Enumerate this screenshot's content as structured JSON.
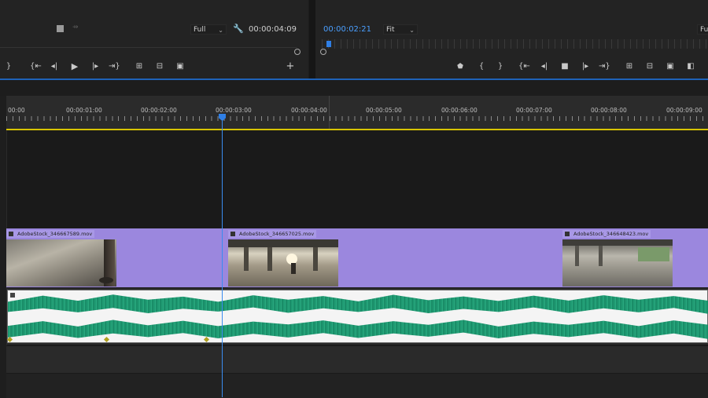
{
  "source_monitor": {
    "quality": "Full",
    "timecode": "00:00:04:09",
    "controls": [
      "}",
      "{←",
      "◂|",
      "▶",
      "|▸",
      "→}",
      "insert",
      "overwrite",
      "export-frame"
    ],
    "add_label": "+"
  },
  "program_monitor": {
    "timecode": "00:00:02:21",
    "zoom": "Fit",
    "quality": "Fu",
    "controls": [
      "marker",
      "{",
      "}",
      "{←",
      "◂|",
      "stop",
      "|▸",
      "→}",
      "lift",
      "extract",
      "export-frame",
      "compare"
    ]
  },
  "timeline": {
    "ruler_labels": [
      "00:00",
      "00:00:01:00",
      "00:00:02:00",
      "00:00:03:00",
      "00:00:04:00",
      "00:00:05:00",
      "00:00:06:00",
      "00:00:07:00",
      "00:00:08:00",
      "00:00:09:00"
    ],
    "playhead_time": "00:00:03:00",
    "clips": [
      {
        "name": "AdobeStock_346667589.mov"
      },
      {
        "name": "AdobeStock_346657025.mov"
      },
      {
        "name": "AdobeStock_346648423.mov"
      }
    ]
  },
  "colors": {
    "accent": "#2f7fe6",
    "clip_video": "#9b87de",
    "clip_audio": "#1f9a72",
    "work_area": "#d8c400"
  }
}
